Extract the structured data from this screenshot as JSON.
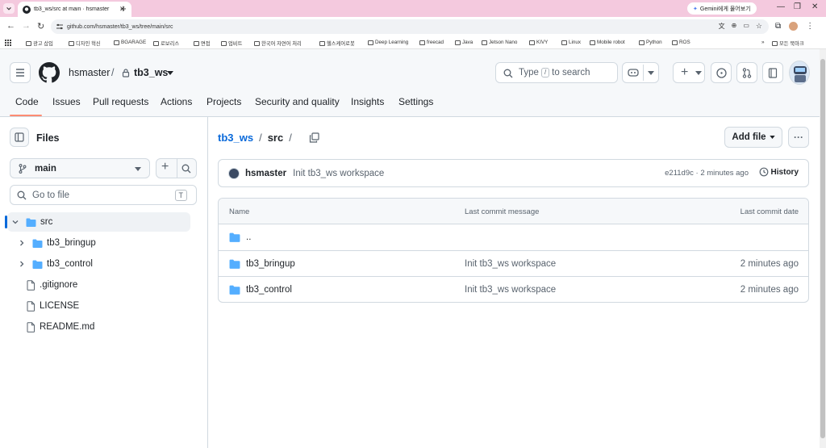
{
  "browser": {
    "tab_title": "tb3_ws/src at main · hsmaster",
    "gemini_label": "Gemini에게 물어보기",
    "url": "github.com/hsmaster/tb3_ws/tree/main/src"
  },
  "bookmarks": [
    "광고 삽입",
    "디자인 혁신",
    "BGARAGE",
    "로보리스",
    "면접",
    "업비트",
    "한국어 자연어 처리",
    "헬스케어로봇",
    "Deep Learning",
    "freecad",
    "Java",
    "Jetson Nano",
    "KIVY",
    "Linux",
    "Mobile robot",
    "Python",
    "ROS"
  ],
  "bookmarks_more": "»",
  "bookmarks_all": "모든 북마크",
  "header": {
    "owner": "hsmaster",
    "separator": "/",
    "repo": "tb3_ws",
    "search_type": "Type",
    "search_key": "/",
    "search_rest": "to search",
    "plus": "+"
  },
  "nav": [
    "Code",
    "Issues",
    "Pull requests",
    "Actions",
    "Projects",
    "Security and quality",
    "Insights",
    "Settings"
  ],
  "sidebar": {
    "title": "Files",
    "branch": "main",
    "goto_placeholder": "Go to file",
    "goto_key": "T",
    "tree": [
      {
        "label": "src",
        "type": "folder",
        "open": true,
        "selected": true,
        "depth": 0
      },
      {
        "label": "tb3_bringup",
        "type": "folder",
        "open": false,
        "depth": 1
      },
      {
        "label": "tb3_control",
        "type": "folder",
        "open": false,
        "depth": 1
      },
      {
        "label": ".gitignore",
        "type": "file",
        "depth": 0
      },
      {
        "label": "LICENSE",
        "type": "file",
        "depth": 0
      },
      {
        "label": "README.md",
        "type": "file",
        "depth": 0
      }
    ]
  },
  "main": {
    "breadcrumb_repo": "tb3_ws",
    "breadcrumb_sep1": "/",
    "breadcrumb_dir": "src",
    "breadcrumb_sep2": "/",
    "add_file": "Add file",
    "more": "···",
    "commit": {
      "author": "hsmaster",
      "message": "Init tb3_ws workspace",
      "meta": "e211d9c · 2 minutes ago",
      "history": "History"
    },
    "table": {
      "col_name": "Name",
      "col_msg": "Last commit message",
      "col_date": "Last commit date",
      "rows": [
        {
          "name": "..",
          "msg": "",
          "date": ""
        },
        {
          "name": "tb3_bringup",
          "msg": "Init tb3_ws workspace",
          "date": "2 minutes ago"
        },
        {
          "name": "tb3_control",
          "msg": "Init tb3_ws workspace",
          "date": "2 minutes ago"
        }
      ]
    }
  },
  "colors": {
    "accent": "#0969da",
    "folder": "#54aeff",
    "underline": "#fd8c73",
    "tabstrip": "#f4c9de"
  }
}
